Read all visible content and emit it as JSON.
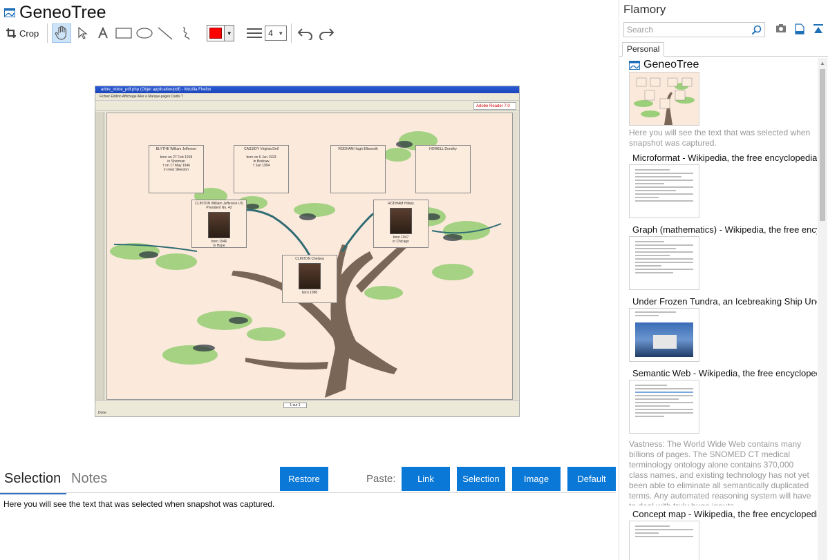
{
  "main": {
    "title": "GeneoTree",
    "toolbar": {
      "crop_label": "Crop",
      "tools": [
        "hand-icon",
        "pointer-icon",
        "text-tool-icon",
        "rectangle-icon",
        "ellipse-icon",
        "line-icon",
        "freehand-icon"
      ],
      "color": "#ff0000",
      "line_width": "4",
      "undo": "undo-icon",
      "redo": "redo-icon"
    },
    "snapshot": {
      "window_title": "arbre_mixte_pdf.php (Objet application/pdf) - Mozilla Firefox",
      "menu": "Fichier   Édition   Affichage   Aller à   Marque-pages   Outils   ?",
      "adobe": "Adobe Reader 7.0",
      "page_indicator": "1 sur 1",
      "status": "Done",
      "boxes": [
        {
          "name": "BLYTHE William Jefferson",
          "line1": "born on 27 Feb 1918",
          "line2": "in Sherman",
          "line3": "† on 17 May 1946",
          "line4": "in near Sikeston"
        },
        {
          "name": "CASSIDY Virginia Dell",
          "line1": "born on 6 Jun 1923",
          "line2": "in Bodcaw",
          "line3": "† Jan 1994",
          "line4": ""
        },
        {
          "name": "RODHAM Hugh Ellsworth",
          "line1": "",
          "line2": "",
          "line3": "",
          "line4": ""
        },
        {
          "name": "HOWELL Dorothy",
          "line1": "",
          "line2": "",
          "line3": "",
          "line4": ""
        },
        {
          "name": "CLINTON William Jefferson US President No. 42",
          "line1": "born 1946",
          "line2": "in Hope"
        },
        {
          "name": "RODHAM Hillary",
          "line1": "born 1947",
          "line2": "in Chicago"
        },
        {
          "name": "CLINTON Chelsea",
          "line1": "born 1980"
        }
      ]
    },
    "tabs": {
      "selection": "Selection",
      "notes": "Notes"
    },
    "buttons": {
      "restore": "Restore",
      "paste_label": "Paste:",
      "link": "Link",
      "selection": "Selection",
      "image": "Image",
      "default": "Default"
    },
    "selection_text": "Here you will see the text that was selected when snapshot was captured."
  },
  "sidebar": {
    "title": "Flamory",
    "search_placeholder": "Search",
    "tab": "Personal",
    "entries": [
      {
        "title": "GeneoTree",
        "desc": "Here you will see the text that was selected when snapshot was captured."
      },
      {
        "title": "Microformat - Wikipedia, the free encyclopedia",
        "desc": ""
      },
      {
        "title": "Graph (mathematics) - Wikipedia, the free ency",
        "desc": ""
      },
      {
        "title": "Under Frozen Tundra, an Icebreaking Ship Unco",
        "desc": ""
      },
      {
        "title": "Semantic Web - Wikipedia, the free encycloped",
        "desc": "Vastness: The World Wide Web contains many billions of pages. The SNOMED CT medical terminology ontology alone contains 370,000 class names, and existing technology has not yet been able to eliminate all semantically duplicated terms. Any automated reasoning system will have to deal with truly huge inputs."
      },
      {
        "title": "Concept map - Wikipedia, the free encyclopedia",
        "desc": ""
      }
    ]
  }
}
